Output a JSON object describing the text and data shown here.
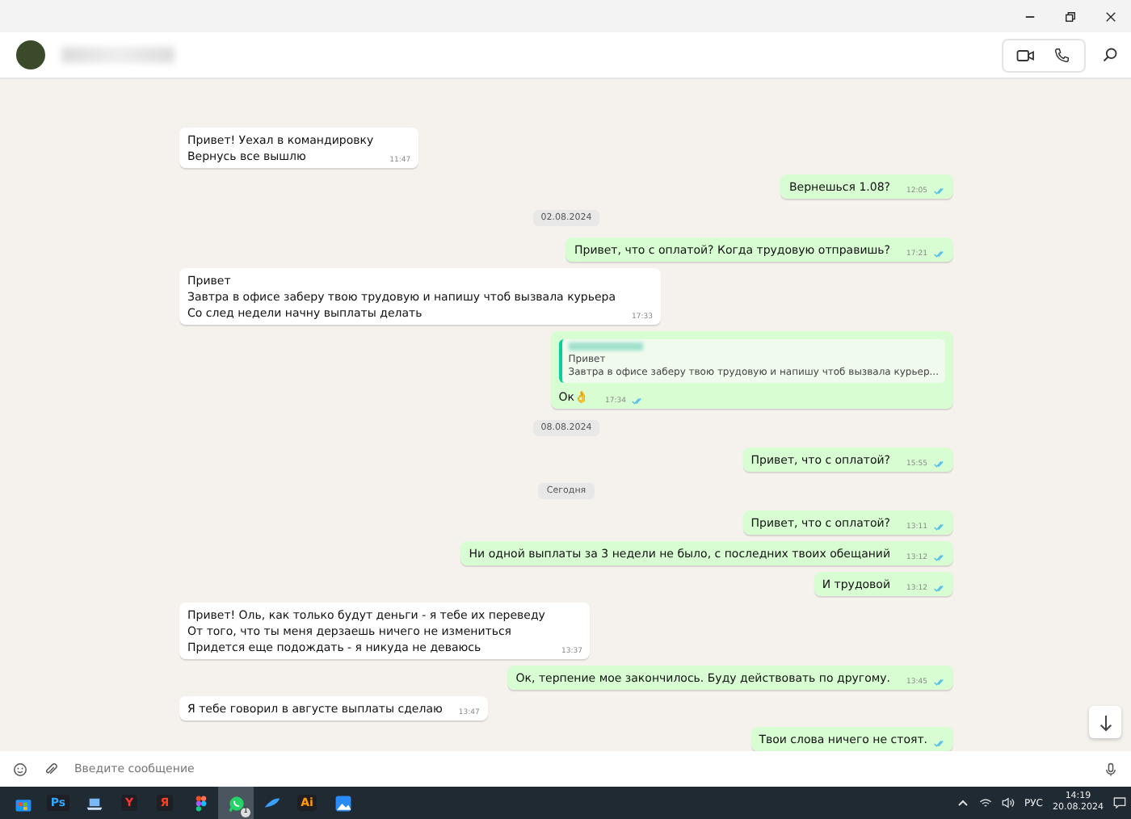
{
  "messages": [
    {
      "kind": "in",
      "lines": [
        "Привет! Уехал в командировку",
        "Вернусь все вышлю"
      ],
      "time": "11:47"
    },
    {
      "kind": "out",
      "lines": [
        "Вернешься 1.08?"
      ],
      "time": "12:05",
      "read": true
    },
    {
      "kind": "date",
      "text": "02.08.2024"
    },
    {
      "kind": "out",
      "lines": [
        "Привет, что с оплатой? Когда трудовую отправишь?"
      ],
      "time": "17:21",
      "read": true
    },
    {
      "kind": "in",
      "lines": [
        "Привет",
        "Завтра в офисе заберу твою трудовую и напишу чтоб вызвала курьера",
        "Со след недели начну выплаты делать"
      ],
      "time": "17:33"
    },
    {
      "kind": "reply",
      "quote": [
        "Привет",
        "Завтра в офисе заберу твою трудовую и напишу чтоб вызвала курьер..."
      ],
      "lines": [
        "Ок👌"
      ],
      "time": "17:34",
      "read": true
    },
    {
      "kind": "date",
      "text": "08.08.2024"
    },
    {
      "kind": "out",
      "lines": [
        "Привет, что с оплатой?"
      ],
      "time": "15:55",
      "read": true
    },
    {
      "kind": "date",
      "text": "Сегодня"
    },
    {
      "kind": "out",
      "lines": [
        "Привет, что с оплатой?"
      ],
      "time": "13:11",
      "read": true
    },
    {
      "kind": "out",
      "lines": [
        "Ни одной выплаты за 3 недели не было, с последних твоих обещаний"
      ],
      "time": "13:12",
      "read": true
    },
    {
      "kind": "out",
      "lines": [
        "И трудовой"
      ],
      "time": "13:12",
      "read": true
    },
    {
      "kind": "in",
      "lines": [
        "Привет! Оль, как только будут деньги - я тебе их переведу",
        "От того, что ты меня дерзаешь ничего не измениться",
        "Придется еще подождать - я никуда не деваюсь"
      ],
      "time": "13:37"
    },
    {
      "kind": "out",
      "lines": [
        "Ок, терпение мое закончилось. Буду действовать по другому."
      ],
      "time": "13:45",
      "read": true
    },
    {
      "kind": "in",
      "lines": [
        "Я тебе говорил в августе выплаты сделаю"
      ],
      "time": "13:47"
    },
    {
      "kind": "out",
      "lines": [
        "Твои слова ничего не стоят."
      ],
      "read": true
    }
  ],
  "composer": {
    "placeholder": "Введите сообщение"
  },
  "taskbar": {
    "apps": [
      {
        "kind": "store"
      },
      {
        "kind": "text",
        "label": "Ps",
        "color": "#31a8ff"
      },
      {
        "kind": "laptop"
      },
      {
        "kind": "text",
        "label": "Y",
        "color": "#ff3333"
      },
      {
        "kind": "text",
        "label": "Я",
        "color": "#fc3f1d"
      },
      {
        "kind": "figma"
      },
      {
        "kind": "chat",
        "badge": "1",
        "selected": true
      },
      {
        "kind": "wing",
        "selected": false
      },
      {
        "kind": "text",
        "label": "Ai",
        "color": "#ff9a00"
      },
      {
        "kind": "photo"
      }
    ],
    "language": "РУС",
    "time": "14:19",
    "date": "20.08.2024"
  }
}
